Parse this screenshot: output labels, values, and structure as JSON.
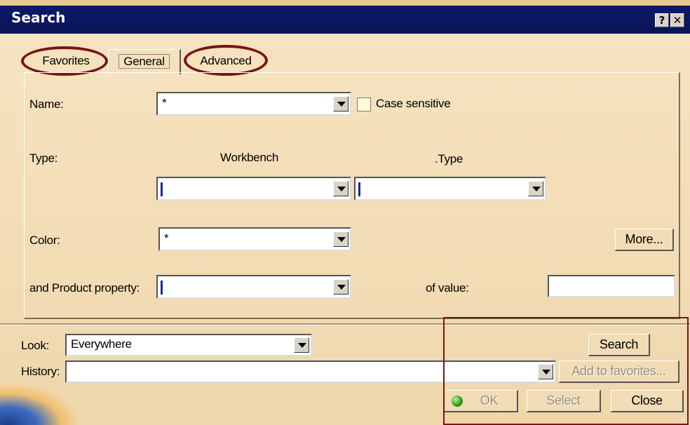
{
  "window": {
    "title": "Search",
    "help_label": "?",
    "close_label": "✕"
  },
  "tabs": [
    {
      "label": "Favorites",
      "active": false
    },
    {
      "label": "General",
      "active": true
    },
    {
      "label": "Advanced",
      "active": false
    }
  ],
  "general": {
    "name_label": "Name:",
    "name_value": "*",
    "case_sensitive_label": "Case sensitive",
    "case_sensitive_checked": false,
    "type_label": "Type:",
    "workbench_header": "Workbench",
    "type_header": ".Type",
    "workbench_value": "",
    "type_value": "",
    "color_label": "Color:",
    "color_value": "*",
    "more_label": "More...",
    "product_property_label": "and Product property:",
    "product_property_value": "",
    "of_value_label": "of value:",
    "of_value_value": ""
  },
  "bottom": {
    "look_label": "Look:",
    "look_value": "Everywhere",
    "history_label": "History:",
    "history_value": "",
    "search_label": "Search",
    "add_favorites_label": "Add to favorites...",
    "ok_label": "OK",
    "select_label": "Select",
    "close_label": "Close"
  },
  "colors": {
    "titlebar": "#0a1456",
    "dialog_bg": "#f3ddb6",
    "annotation_red": "#7a1414"
  }
}
